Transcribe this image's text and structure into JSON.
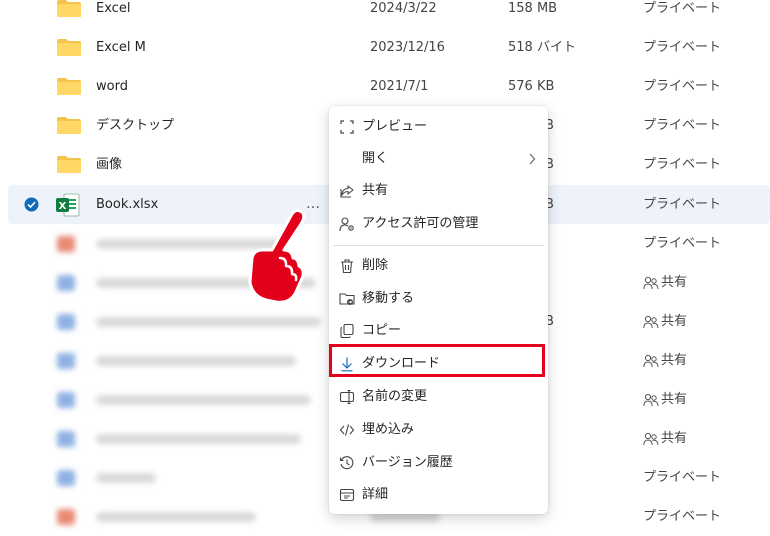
{
  "colors": {
    "accent": "#0f6cbd",
    "highlight": "#e3001b",
    "folder": "#f4c34c",
    "excel": "#107c41"
  },
  "files": [
    {
      "name": "Excel",
      "date": "2024/3/22",
      "size": "158 MB",
      "share": "プライベート"
    },
    {
      "name": "Excel M",
      "date": "2023/12/16",
      "size": "518 バイト",
      "share": "プライベート"
    },
    {
      "name": "word",
      "date": "2021/7/1",
      "size": "576 KB",
      "share": "プライベート"
    },
    {
      "name": "デスクトップ",
      "date": "",
      "size": "",
      "share": "プライベート"
    },
    {
      "name": "画像",
      "date": "",
      "size": "",
      "share": "プライベート"
    }
  ],
  "selected_file": {
    "name": "Book.xlsx",
    "share": "プライベート",
    "more": "…"
  },
  "blurred_rows": [
    {
      "share": "プライベート",
      "people": false
    },
    {
      "share": "共有",
      "people": true
    },
    {
      "share": "共有",
      "people": true
    },
    {
      "share": "共有",
      "people": true
    },
    {
      "share": "共有",
      "people": true
    },
    {
      "share": "共有",
      "people": true
    },
    {
      "share": "プライベート",
      "people": false
    },
    {
      "share": "プライベート",
      "people": false
    }
  ],
  "menu": {
    "preview": "プレビュー",
    "open": "開く",
    "share": "共有",
    "manage_access": "アクセス許可の管理",
    "delete": "削除",
    "move": "移動する",
    "copy": "コピー",
    "download": "ダウンロード",
    "rename": "名前の変更",
    "embed": "埋め込み",
    "version_history": "バージョン履歴",
    "details": "詳細"
  },
  "peek_texts": {
    "b1": "B",
    "b2": "B",
    "b3": "B"
  }
}
